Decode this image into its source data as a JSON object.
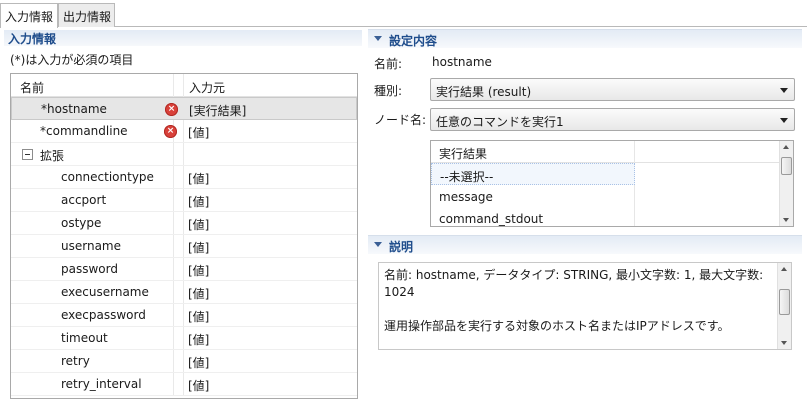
{
  "tabs": [
    {
      "label": "入力情報",
      "active": true
    },
    {
      "label": "出力情報",
      "active": false
    }
  ],
  "input_panel": {
    "title": "入力情報",
    "required_note": "(*)は入力が必須の項目",
    "columns": {
      "name": "名前",
      "source": "入力元"
    },
    "rows": [
      {
        "label": "*hostname",
        "value": "[実行結果]",
        "error": true,
        "selected": true
      },
      {
        "label": "*commandline",
        "value": "[値]",
        "error": true
      },
      {
        "label": "拡張",
        "value": "",
        "group": true
      },
      {
        "label": "connectiontype",
        "value": "[値]"
      },
      {
        "label": "accport",
        "value": "[値]"
      },
      {
        "label": "ostype",
        "value": "[値]"
      },
      {
        "label": "username",
        "value": "[値]"
      },
      {
        "label": "password",
        "value": "[値]"
      },
      {
        "label": "execusername",
        "value": "[値]"
      },
      {
        "label": "execpassword",
        "value": "[値]"
      },
      {
        "label": "timeout",
        "value": "[値]"
      },
      {
        "label": "retry",
        "value": "[値]"
      },
      {
        "label": "retry_interval",
        "value": "[値]"
      }
    ]
  },
  "settings": {
    "title": "設定内容",
    "name_label": "名前:",
    "name_value": "hostname",
    "type_label": "種別:",
    "type_value": "実行結果 (result)",
    "node_label": "ノード名:",
    "node_value": "任意のコマンドを実行1",
    "result_list": {
      "header": "実行結果",
      "items": [
        "--未選択--",
        "message",
        "command_stdout"
      ]
    }
  },
  "description": {
    "title": "説明",
    "text": "名前: hostname, データタイプ: STRING, 最小文字数: 1, 最大文字数: 1024\n\n運用操作部品を実行する対象のホスト名またはIPアドレスです。"
  },
  "colors": {
    "section_header_text": "#1f4d8c",
    "error_icon": "#d9413a",
    "selected_row": "#e6e6e6"
  }
}
